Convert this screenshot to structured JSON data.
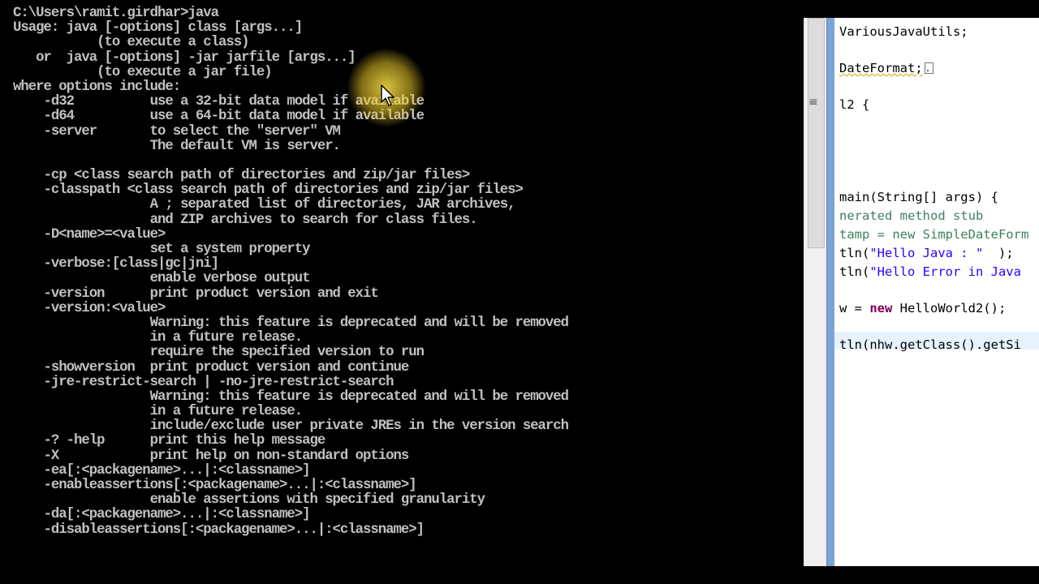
{
  "console": {
    "lines": [
      "C:\\Users\\ramit.girdhar>java",
      "Usage: java [-options] class [args...]",
      "           (to execute a class)",
      "   or  java [-options] -jar jarfile [args...]",
      "           (to execute a jar file)",
      "where options include:",
      "    -d32          use a 32-bit data model if available",
      "    -d64          use a 64-bit data model if available",
      "    -server       to select the \"server\" VM",
      "                  The default VM is server.",
      "",
      "    -cp <class search path of directories and zip/jar files>",
      "    -classpath <class search path of directories and zip/jar files>",
      "                  A ; separated list of directories, JAR archives,",
      "                  and ZIP archives to search for class files.",
      "    -D<name>=<value>",
      "                  set a system property",
      "    -verbose:[class|gc|jni]",
      "                  enable verbose output",
      "    -version      print product version and exit",
      "    -version:<value>",
      "                  Warning: this feature is deprecated and will be removed",
      "                  in a future release.",
      "                  require the specified version to run",
      "    -showversion  print product version and continue",
      "    -jre-restrict-search | -no-jre-restrict-search",
      "                  Warning: this feature is deprecated and will be removed",
      "                  in a future release.",
      "                  include/exclude user private JREs in the version search",
      "    -? -help      print this help message",
      "    -X            print help on non-standard options",
      "    -ea[:<packagename>...|:<classname>]",
      "    -enableassertions[:<packagename>...|:<classname>]",
      "                  enable assertions with specified granularity",
      "    -da[:<packagename>...|:<classname>]",
      "    -disableassertions[:<packagename>...|:<classname>]"
    ]
  },
  "editor": {
    "line1": "VariousJavaUtils;",
    "line2": "DateFormat;",
    "line3": "l2 {",
    "line4a": "main(String[] args) {",
    "line5": "nerated method stub",
    "line6": "tamp = new SimpleDateForm",
    "line7a": "tln(",
    "line7b": "\"Hello Java : \"",
    "line7c": "  );",
    "line8a": "tln(",
    "line8b": "\"Hello Error in Java",
    "line9a": "w = ",
    "line9kw": "new",
    "line9b": " HelloWorld2();",
    "line10": "tln(nhw.getClass().getSi"
  },
  "colors": {
    "console_text": "#c0c0c0",
    "console_bg": "#000000",
    "keyword": "#7f0055",
    "string": "#2a00ff",
    "comment": "#3f7f5f"
  },
  "icons": {
    "cursor": "arrow-cursor-icon",
    "highlight": "cursor-highlight-icon"
  }
}
